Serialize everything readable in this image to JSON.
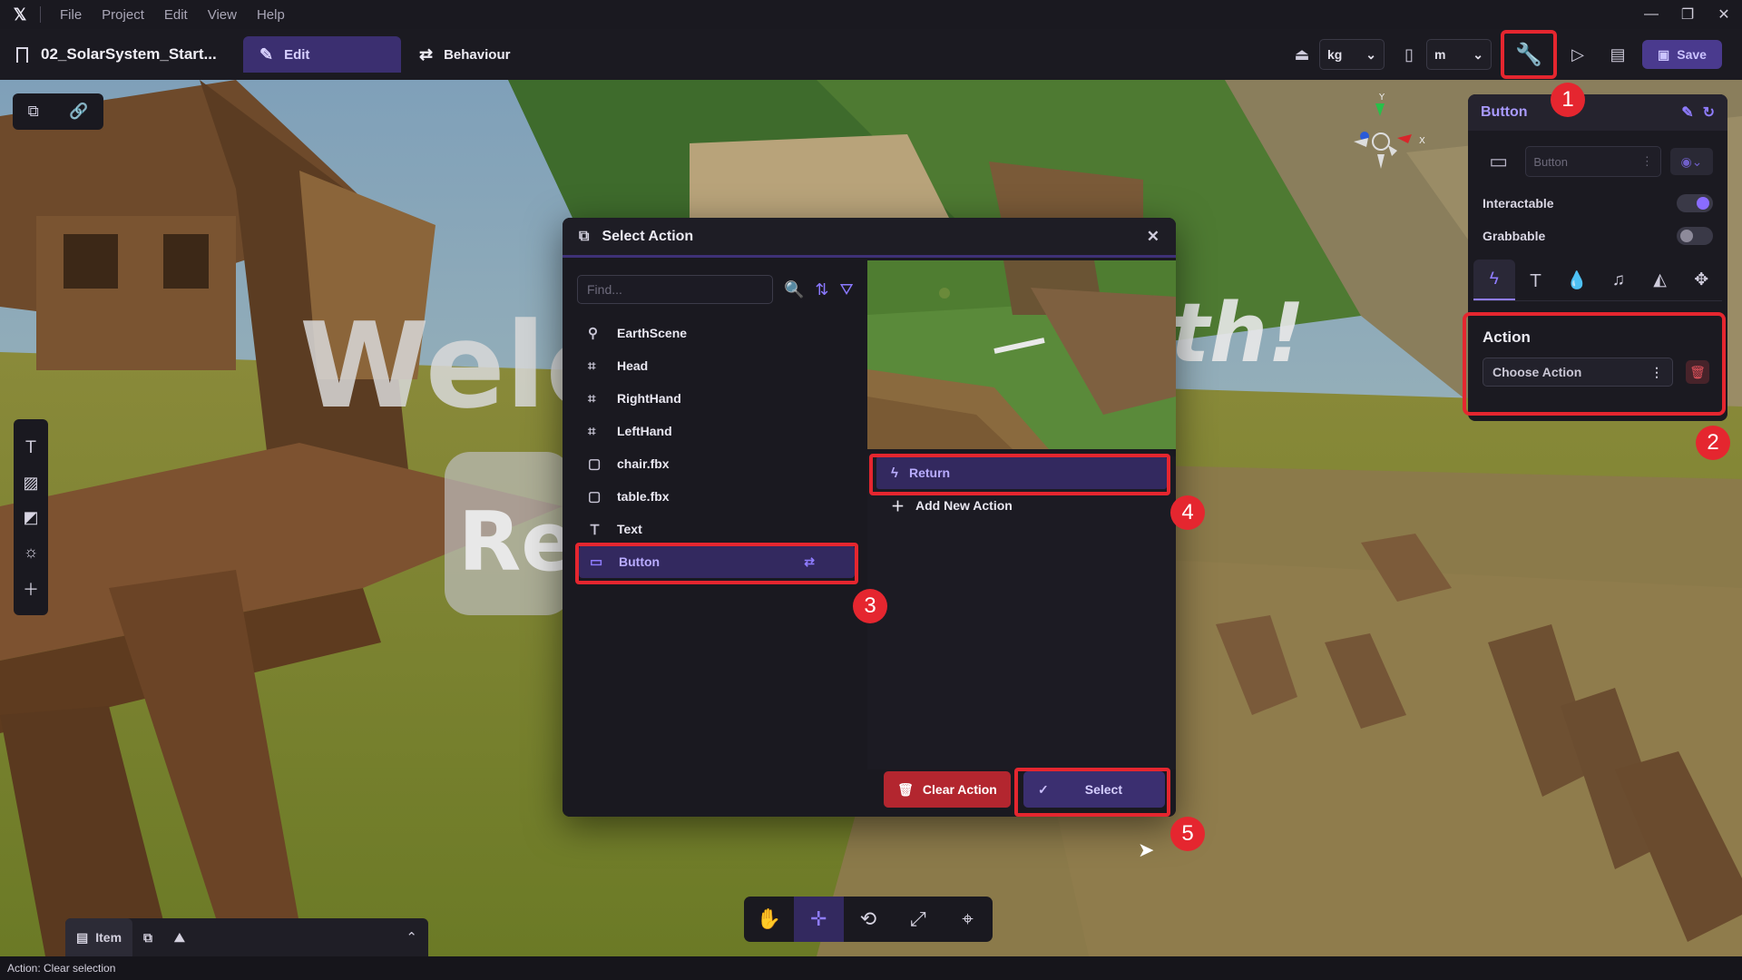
{
  "menubar": {
    "logo": "𝕏",
    "items": [
      {
        "label": "File"
      },
      {
        "label": "Project"
      },
      {
        "label": "Edit"
      },
      {
        "label": "View"
      },
      {
        "label": "Help"
      }
    ],
    "window_controls": [
      "minimize-icon",
      "restore-icon",
      "close-icon"
    ]
  },
  "toolbar": {
    "project_title": "02_SolarSystem_Start...",
    "tabs": [
      {
        "label": "Edit",
        "icon": "pencil-icon",
        "active": true
      },
      {
        "label": "Behaviour",
        "icon": "flow-icon",
        "active": false
      }
    ],
    "mass_unit": "kg",
    "length_unit": "m",
    "save_label": "Save"
  },
  "properties": {
    "title": "Button",
    "name_placeholder": "Button",
    "toggles": [
      {
        "label": "Interactable",
        "on": true
      },
      {
        "label": "Grabbable",
        "on": false
      }
    ],
    "component_tabs": [
      "lightning-icon",
      "text-icon",
      "drop-icon",
      "music-icon",
      "material-icon",
      "move-icon"
    ],
    "action_title": "Action",
    "action_value": "Choose Action"
  },
  "dialog": {
    "title": "Select Action",
    "search_placeholder": "Find...",
    "objects": [
      {
        "label": "EarthScene",
        "icon": "location-icon"
      },
      {
        "label": "Head",
        "icon": "rig-icon"
      },
      {
        "label": "RightHand",
        "icon": "rig-icon"
      },
      {
        "label": "LeftHand",
        "icon": "rig-icon"
      },
      {
        "label": "chair.fbx",
        "icon": "cube-icon"
      },
      {
        "label": "table.fbx",
        "icon": "cube-icon"
      },
      {
        "label": "Text",
        "icon": "text-icon"
      },
      {
        "label": "Button",
        "icon": "button-icon",
        "selected": true
      }
    ],
    "actions": [
      {
        "label": "Return",
        "icon": "lightning-icon",
        "selected": true
      },
      {
        "label": "Add New Action",
        "icon": "plus-icon"
      }
    ],
    "clear_label": "Clear Action",
    "select_label": "Select"
  },
  "viewport": {
    "welcome_text": "Welc",
    "earth_text": "th!",
    "return_text": "Re"
  },
  "markers": [
    "1",
    "2",
    "3",
    "4",
    "5"
  ],
  "bottom_panel": {
    "item_tab": "Item"
  },
  "status": "Action: Clear selection"
}
